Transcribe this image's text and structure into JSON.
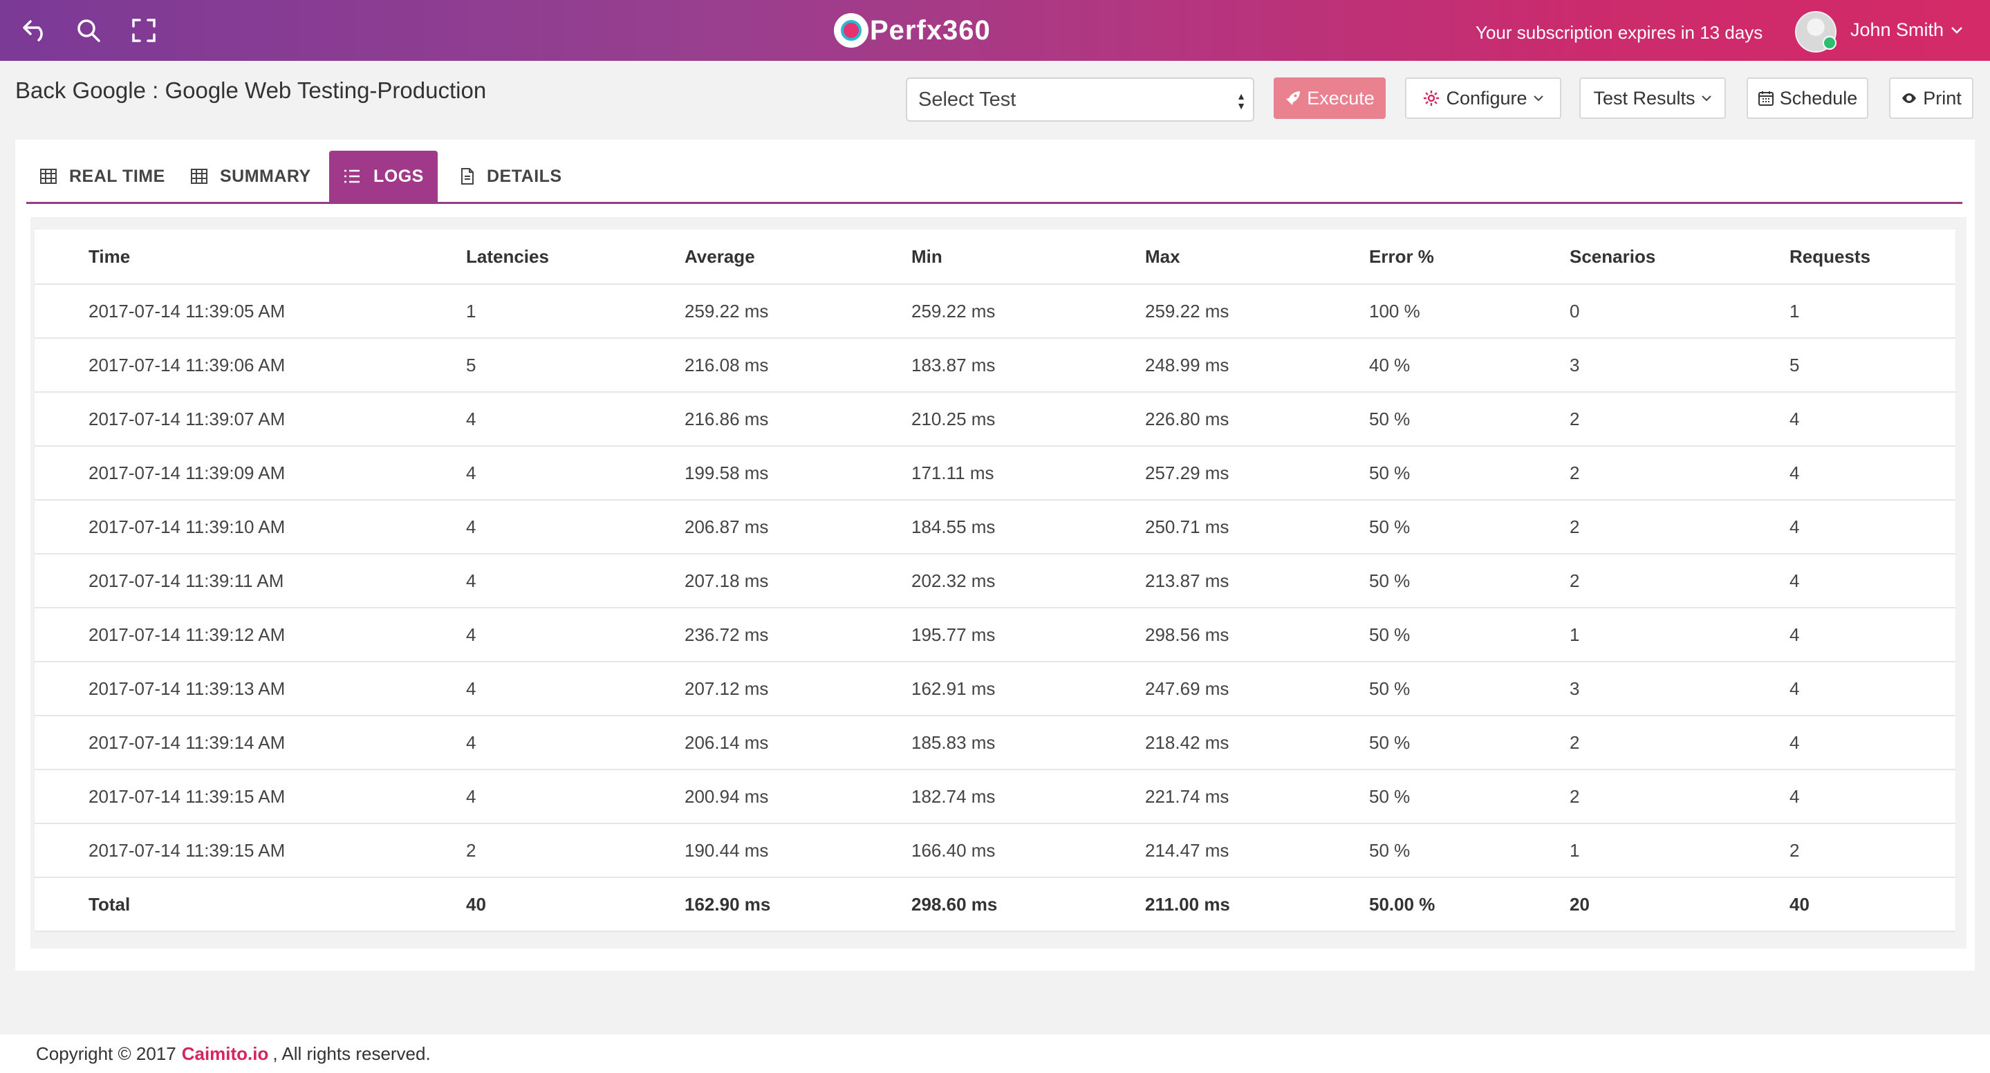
{
  "header": {
    "logo_text": "Perfx360",
    "subscription": "Your subscription expires in 13 days",
    "user_name": "John Smith"
  },
  "toolbar": {
    "page_title": "Back Google : Google Web Testing-Production",
    "select_test": "Select Test",
    "execute": "Execute",
    "configure": "Configure",
    "test_results": "Test Results",
    "schedule": "Schedule",
    "print": "Print"
  },
  "tabs": [
    {
      "label": "REAL TIME",
      "active": false
    },
    {
      "label": "SUMMARY",
      "active": false
    },
    {
      "label": "LOGS",
      "active": true
    },
    {
      "label": "DETAILS",
      "active": false
    }
  ],
  "table": {
    "columns": [
      "Time",
      "Latencies",
      "Average",
      "Min",
      "Max",
      "Error %",
      "Scenarios",
      "Requests"
    ],
    "rows": [
      [
        "2017-07-14 11:39:05 AM",
        "1",
        "259.22 ms",
        "259.22 ms",
        "259.22 ms",
        "100 %",
        "0",
        "1"
      ],
      [
        "2017-07-14 11:39:06 AM",
        "5",
        "216.08 ms",
        "183.87 ms",
        "248.99 ms",
        "40 %",
        "3",
        "5"
      ],
      [
        "2017-07-14 11:39:07 AM",
        "4",
        "216.86 ms",
        "210.25 ms",
        "226.80 ms",
        "50 %",
        "2",
        "4"
      ],
      [
        "2017-07-14 11:39:09 AM",
        "4",
        "199.58 ms",
        "171.11 ms",
        "257.29 ms",
        "50 %",
        "2",
        "4"
      ],
      [
        "2017-07-14 11:39:10 AM",
        "4",
        "206.87 ms",
        "184.55 ms",
        "250.71 ms",
        "50 %",
        "2",
        "4"
      ],
      [
        "2017-07-14 11:39:11 AM",
        "4",
        "207.18 ms",
        "202.32 ms",
        "213.87 ms",
        "50 %",
        "2",
        "4"
      ],
      [
        "2017-07-14 11:39:12 AM",
        "4",
        "236.72 ms",
        "195.77 ms",
        "298.56 ms",
        "50 %",
        "1",
        "4"
      ],
      [
        "2017-07-14 11:39:13 AM",
        "4",
        "207.12 ms",
        "162.91 ms",
        "247.69 ms",
        "50 %",
        "3",
        "4"
      ],
      [
        "2017-07-14 11:39:14 AM",
        "4",
        "206.14 ms",
        "185.83 ms",
        "218.42 ms",
        "50 %",
        "2",
        "4"
      ],
      [
        "2017-07-14 11:39:15 AM",
        "4",
        "200.94 ms",
        "182.74 ms",
        "221.74 ms",
        "50 %",
        "2",
        "4"
      ],
      [
        "2017-07-14 11:39:15 AM",
        "2",
        "190.44 ms",
        "166.40 ms",
        "214.47 ms",
        "50 %",
        "1",
        "2"
      ]
    ],
    "total": [
      "Total",
      "40",
      "162.90 ms",
      "298.60 ms",
      "211.00 ms",
      "50.00 %",
      "20",
      "40"
    ]
  },
  "footer": {
    "copyright": "Copyright © 2017",
    "brand": "Caimito.io",
    "suffix": ", All rights reserved."
  },
  "colors": {
    "header_gradient_start": "#7b3a96",
    "header_gradient_end": "#d42a67",
    "active_tab": "#a0398a",
    "execute_button": "#e9818f",
    "brand_link": "#d6245f"
  },
  "icons": {
    "back": "undo-arrow-icon",
    "search": "search-icon",
    "fullscreen": "expand-icon",
    "execute": "rocket-icon",
    "configure": "gear-icon",
    "schedule": "calendar-icon",
    "print": "eye-icon",
    "tab_real_time": "table-icon",
    "tab_summary": "table-icon",
    "tab_logs": "list-icon",
    "tab_details": "document-icon"
  }
}
